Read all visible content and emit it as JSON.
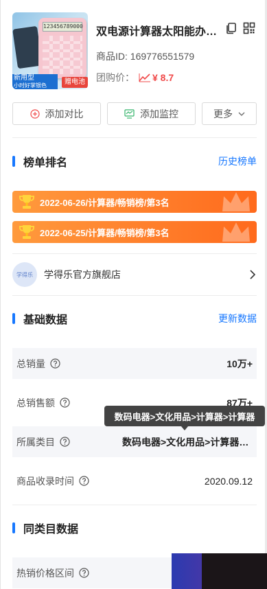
{
  "product": {
    "title": "双电源计算器太阳能办…",
    "id_label": "商品ID: 169776551579",
    "price_label": "团购价：",
    "price_value": "¥ 8.7",
    "thumb": {
      "screen_text": "123456789000",
      "tag_left_line1": "新用型",
      "tag_left_line2": "小时好掌银色",
      "tag_right": "赠电池"
    }
  },
  "actions": {
    "compare": "添加对比",
    "monitor": "添加监控",
    "more": "更多"
  },
  "ranking": {
    "title": "榜单排名",
    "link": "历史榜单",
    "items": [
      "2022-06-26/计算器/畅销榜/第3名",
      "2022-06-25/计算器/畅销榜/第3名"
    ]
  },
  "shop": {
    "avatar_text": "学得乐",
    "name": "学得乐官方旗舰店"
  },
  "basic": {
    "title": "基础数据",
    "link": "更新数据",
    "rows": [
      {
        "label": "总销量",
        "value": "10万+"
      },
      {
        "label": "总销售额",
        "value": "87万+"
      },
      {
        "label": "所属类目",
        "value": "数码电器>文化用品>计算器>..."
      },
      {
        "label": "商品收录时间",
        "value": "2020.09.12"
      }
    ],
    "tooltip": "数码电器>文化用品>计算器>计算器"
  },
  "similar": {
    "title": "同类目数据",
    "rows": [
      {
        "label": "热销价格区间"
      }
    ]
  },
  "colors": {
    "accent": "#1677ff",
    "price": "#f04848",
    "rank_orange": "#ff7d2a"
  }
}
